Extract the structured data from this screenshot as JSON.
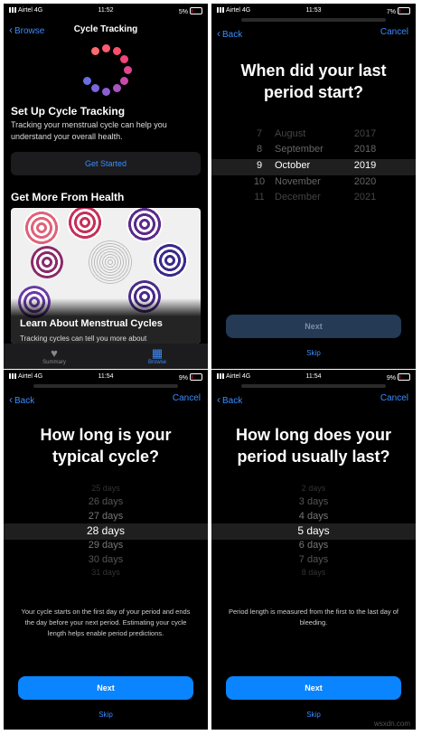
{
  "screen1": {
    "status": {
      "carrier": "Airtel 4G",
      "time": "11:52",
      "battery": "5%"
    },
    "back_label": "Browse",
    "title": "Cycle Tracking",
    "setup_heading": "Set Up Cycle Tracking",
    "setup_body": "Tracking your menstrual cycle can help you understand your overall health.",
    "get_started_label": "Get Started",
    "more_heading": "Get More From Health",
    "card_title": "Learn About Menstrual Cycles",
    "card_sub": "Tracking cycles can tell you more about",
    "tabs": {
      "summary": "Summary",
      "browse": "Browse"
    },
    "colors": {
      "accent": "#3a8cff"
    }
  },
  "screen2": {
    "status": {
      "carrier": "Airtel 4G",
      "time": "11:53",
      "battery": "7%"
    },
    "back_label": "Back",
    "cancel_label": "Cancel",
    "question_line1": "When did your last",
    "question_line2": "period start?",
    "picker": {
      "days": [
        "7",
        "8",
        "9",
        "10",
        "11"
      ],
      "months": [
        "August",
        "September",
        "October",
        "November",
        "December"
      ],
      "years": [
        "2017",
        "2018",
        "2019",
        "2020",
        "2021"
      ],
      "selected": {
        "day": "9",
        "month": "October",
        "year": "2019"
      }
    },
    "next_label": "Next",
    "skip_label": "Skip"
  },
  "screen3": {
    "status": {
      "carrier": "Airtel 4G",
      "time": "11:54",
      "battery": "9%"
    },
    "back_label": "Back",
    "cancel_label": "Cancel",
    "question_line1": "How long is your",
    "question_line2": "typical cycle?",
    "picker": {
      "above": [
        "25 days",
        "26 days",
        "27 days"
      ],
      "selected": "28 days",
      "below": [
        "29 days",
        "30 days",
        "31 days"
      ]
    },
    "note": "Your cycle starts on the first day of your period and ends the day before your next period. Estimating your cycle length helps enable period predictions.",
    "next_label": "Next",
    "skip_label": "Skip"
  },
  "screen4": {
    "status": {
      "carrier": "Airtel 4G",
      "time": "11:54",
      "battery": "9%"
    },
    "back_label": "Back",
    "cancel_label": "Cancel",
    "question_line1": "How long does your",
    "question_line2": "period usually last?",
    "picker": {
      "above": [
        "2 days",
        "3 days",
        "4 days"
      ],
      "selected": "5 days",
      "below": [
        "6 days",
        "7 days",
        "8 days"
      ]
    },
    "note": "Period length is measured from the first to the last day of bleeding.",
    "next_label": "Next",
    "skip_label": "Skip"
  },
  "watermark": "wsxdn.com"
}
